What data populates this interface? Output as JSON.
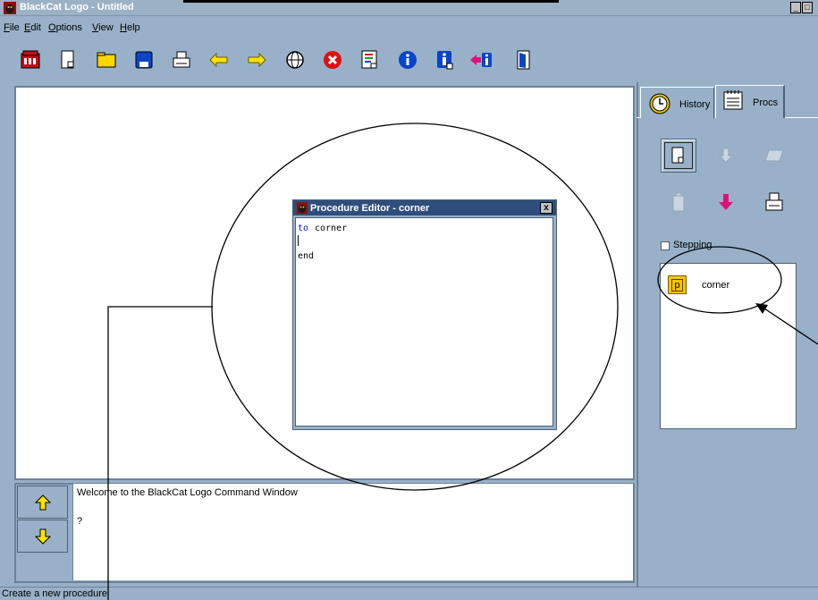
{
  "window": {
    "title": "BlackCat Logo - Untitled",
    "min_glyph": "_",
    "max_glyph": "□"
  },
  "menu": [
    {
      "label": "File"
    },
    {
      "label": "Edit"
    },
    {
      "label": "Options"
    },
    {
      "label": "View"
    },
    {
      "label": "Help"
    }
  ],
  "toolbar": {
    "icons": [
      "blackcat-logo-icon",
      "new-file-icon",
      "open-folder-icon",
      "save-icon",
      "print-icon",
      "undo-icon",
      "redo-icon",
      "web-icon",
      "stop-icon",
      "editor-icon",
      "info-icon",
      "info-doc-icon",
      "import-icon",
      "exit-door-icon"
    ]
  },
  "command": {
    "welcome": "Welcome to the BlackCat Logo Command Window",
    "prompt": "?"
  },
  "status": {
    "text": "Create a new procedure"
  },
  "panel": {
    "tabs": [
      {
        "label": "History",
        "icon": "clock-icon"
      },
      {
        "label": "Procs",
        "icon": "notepad-icon"
      }
    ],
    "stepping_label": "Stepping",
    "stepping_checked": false,
    "procedures": [
      {
        "name": "corner",
        "badge": "p"
      }
    ]
  },
  "editor": {
    "title": "Procedure Editor - corner",
    "close_glyph": "x",
    "code": {
      "keyword": "to",
      "name": "corner",
      "end": "end"
    }
  },
  "colors": {
    "background": "#98b1c8",
    "editor_title": "#2f4e7b",
    "keyword": "#1010c8",
    "proc_badge": "#f7c500"
  }
}
